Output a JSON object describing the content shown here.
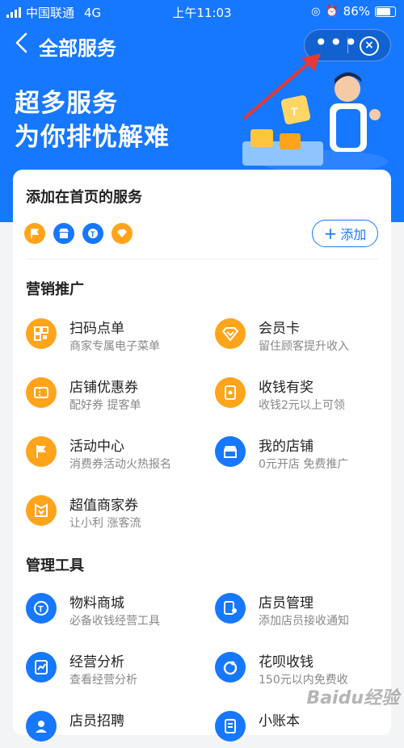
{
  "status": {
    "carrier": "中国联通",
    "network": "4G",
    "time": "上午11:03",
    "battery": "86%"
  },
  "nav": {
    "back": "<",
    "title": "全部服务",
    "more": "•••",
    "close": "×"
  },
  "hero": {
    "line1": "超多服务",
    "line2": "为你排忧解难"
  },
  "pinned": {
    "title": "添加在首页的服务",
    "add_label": "添加"
  },
  "sections": [
    {
      "title": "营销推广",
      "items": [
        {
          "title": "扫码点单",
          "sub": "商家专属电子菜单",
          "icon": "qr-menu-icon",
          "color": "#ffa41b"
        },
        {
          "title": "会员卡",
          "sub": "留住顾客提升收入",
          "icon": "member-card-icon",
          "color": "#ffa41b"
        },
        {
          "title": "店铺优惠券",
          "sub": "配好券 提客单",
          "icon": "coupon-icon",
          "color": "#ffa41b"
        },
        {
          "title": "收钱有奖",
          "sub": "收钱2元以上可领",
          "icon": "reward-icon",
          "color": "#ffa41b"
        },
        {
          "title": "活动中心",
          "sub": "消费券活动火热报名",
          "icon": "flag-icon",
          "color": "#ffa41b"
        },
        {
          "title": "我的店铺",
          "sub": "0元开店 免费推广",
          "icon": "shop-icon",
          "color": "#1677ff"
        },
        {
          "title": "超值商家券",
          "sub": "让小利 涨客流",
          "icon": "merchant-coupon-icon",
          "color": "#ffa41b"
        }
      ]
    },
    {
      "title": "管理工具",
      "items": [
        {
          "title": "物料商城",
          "sub": "必备收钱经营工具",
          "icon": "material-mall-icon",
          "color": "#1677ff"
        },
        {
          "title": "店员管理",
          "sub": "添加店员接收通知",
          "icon": "staff-icon",
          "color": "#1677ff"
        },
        {
          "title": "经营分析",
          "sub": "查看经营分析",
          "icon": "analysis-icon",
          "color": "#1677ff"
        },
        {
          "title": "花呗收钱",
          "sub": "150元以内免费收",
          "icon": "huabei-icon",
          "color": "#1677ff"
        },
        {
          "title": "店员招聘",
          "sub": "",
          "icon": "recruit-icon",
          "color": "#1677ff"
        },
        {
          "title": "小账本",
          "sub": "",
          "icon": "ledger-icon",
          "color": "#1677ff"
        }
      ]
    }
  ],
  "watermark": "Baidu经验"
}
